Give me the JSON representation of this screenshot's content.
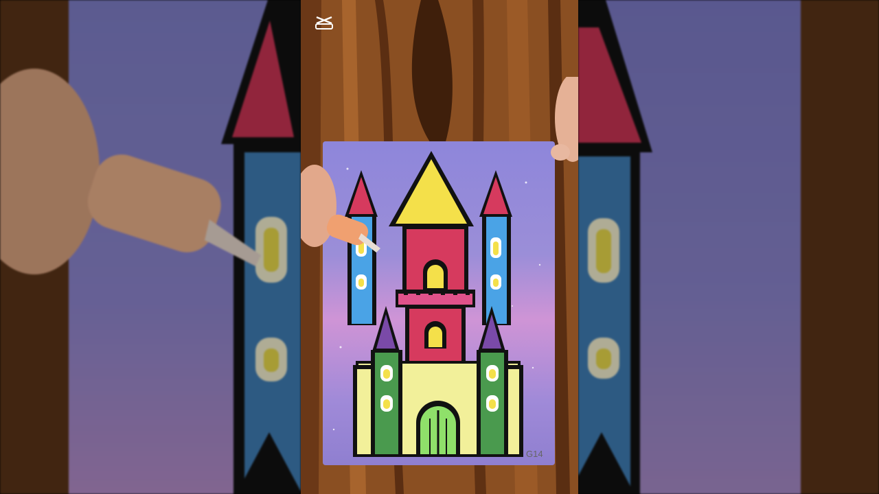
{
  "video": {
    "watermark_icon": "capcut-logo-icon",
    "card_code": "G14"
  },
  "colors": {
    "wood": "#8a4f22",
    "wood_dark": "#4a2610",
    "sky_purple": "#8f7fd0",
    "sky_pink": "#d08fd0",
    "roof_red": "#d63a5e",
    "roof_yellow": "#f4e04a",
    "tower_blue": "#4aa3e6",
    "tower_green": "#4a9a4e",
    "wall_cream": "#f2f09a",
    "door_green": "#8fe06a",
    "roof_purple": "#7a4aa8",
    "outline": "#1a1a1a"
  }
}
